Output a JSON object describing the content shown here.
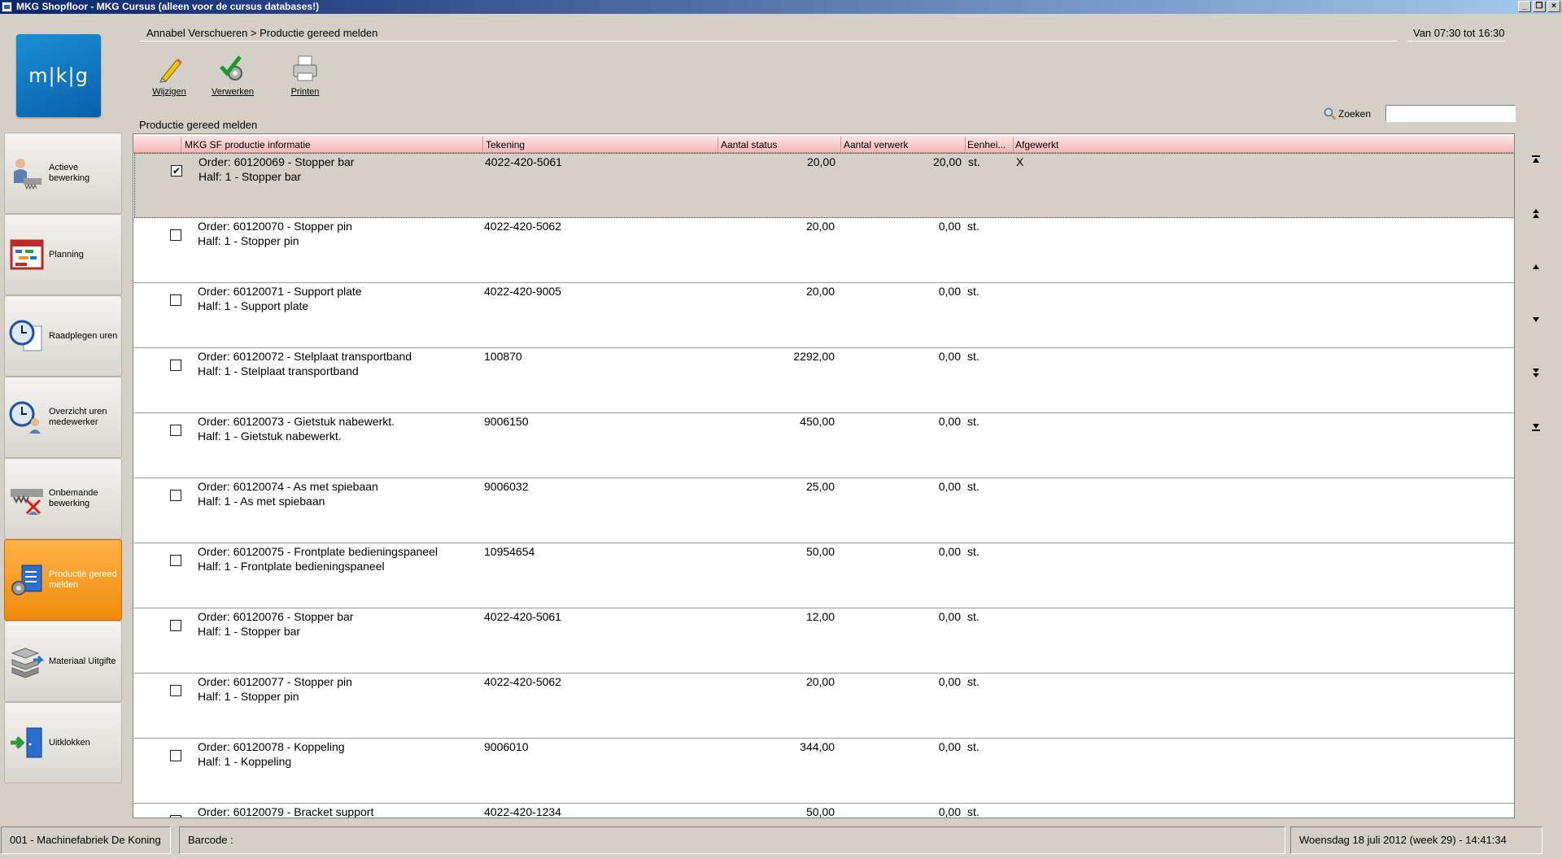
{
  "window": {
    "title": "MKG Shopfloor - MKG Cursus (alleen voor de cursus databases!)"
  },
  "logo": {
    "text": "m|k|g"
  },
  "header": {
    "breadcrumb": "Annabel Verschueren > Productie gereed melden",
    "shift": "Van 07:30 tot 16:30"
  },
  "toolbar": {
    "wijzigen": "Wijzigen",
    "verwerken": "Verwerken",
    "printen": "Printen"
  },
  "search": {
    "label": "Zoeken",
    "value": ""
  },
  "section_title": "Productie gereed melden",
  "sidebar": {
    "items": [
      {
        "label": "Actieve bewerking",
        "icon": "worker-machine-icon",
        "active": false
      },
      {
        "label": "Planning",
        "icon": "planning-calendar-icon",
        "active": false
      },
      {
        "label": "Raadplegen uren",
        "icon": "clock-document-icon",
        "active": false
      },
      {
        "label": "Overzicht uren medewerker",
        "icon": "clock-person-icon",
        "active": false
      },
      {
        "label": "Onbemande bewerking",
        "icon": "unmanned-machine-icon",
        "active": false
      },
      {
        "label": "Productie gereed melden",
        "icon": "production-report-icon",
        "active": true
      },
      {
        "label": "Materiaal Uitgifte",
        "icon": "material-stack-icon",
        "active": false
      },
      {
        "label": "Uitklokken",
        "icon": "door-exit-icon",
        "active": false
      }
    ]
  },
  "grid": {
    "columns": {
      "info": "MKG SF productie informatie",
      "tekening": "Tekening",
      "status": "Aantal status",
      "verwerk": "Aantal verwerk",
      "eenheid": "Eenhei...",
      "afgewerkt": "Afgewerkt"
    },
    "rows": [
      {
        "checked": true,
        "order": "Order: 60120069 - Stopper bar",
        "half": "Half: 1 - Stopper bar",
        "tekening": "4022-420-5061",
        "status": "20,00",
        "verwerk": "20,00",
        "eenheid": "st.",
        "afgewerkt": "X"
      },
      {
        "checked": false,
        "order": "Order: 60120070 - Stopper pin",
        "half": "Half: 1 - Stopper pin",
        "tekening": "4022-420-5062",
        "status": "20,00",
        "verwerk": "0,00",
        "eenheid": "st.",
        "afgewerkt": ""
      },
      {
        "checked": false,
        "order": "Order: 60120071 - Support plate",
        "half": "Half: 1 - Support plate",
        "tekening": "4022-420-9005",
        "status": "20,00",
        "verwerk": "0,00",
        "eenheid": "st.",
        "afgewerkt": ""
      },
      {
        "checked": false,
        "order": "Order: 60120072 - Stelplaat transportband",
        "half": "Half: 1 - Stelplaat transportband",
        "tekening": "100870",
        "status": "2292,00",
        "verwerk": "0,00",
        "eenheid": "st.",
        "afgewerkt": ""
      },
      {
        "checked": false,
        "order": "Order: 60120073 - Gietstuk nabewerkt.",
        "half": "Half: 1 - Gietstuk nabewerkt.",
        "tekening": "9006150",
        "status": "450,00",
        "verwerk": "0,00",
        "eenheid": "st.",
        "afgewerkt": ""
      },
      {
        "checked": false,
        "order": "Order: 60120074 - As met spiebaan",
        "half": "Half: 1 - As met spiebaan",
        "tekening": "9006032",
        "status": "25,00",
        "verwerk": "0,00",
        "eenheid": "st.",
        "afgewerkt": ""
      },
      {
        "checked": false,
        "order": "Order: 60120075 - Frontplate bedieningspaneel",
        "half": "Half: 1 - Frontplate bedieningspaneel",
        "tekening": "10954654",
        "status": "50,00",
        "verwerk": "0,00",
        "eenheid": "st.",
        "afgewerkt": ""
      },
      {
        "checked": false,
        "order": "Order: 60120076 - Stopper bar",
        "half": "Half: 1 - Stopper bar",
        "tekening": "4022-420-5061",
        "status": "12,00",
        "verwerk": "0,00",
        "eenheid": "st.",
        "afgewerkt": ""
      },
      {
        "checked": false,
        "order": "Order: 60120077 - Stopper pin",
        "half": "Half: 1 - Stopper pin",
        "tekening": "4022-420-5062",
        "status": "20,00",
        "verwerk": "0,00",
        "eenheid": "st.",
        "afgewerkt": ""
      },
      {
        "checked": false,
        "order": "Order: 60120078 - Koppeling",
        "half": "Half: 1 - Koppeling",
        "tekening": "9006010",
        "status": "344,00",
        "verwerk": "0,00",
        "eenheid": "st.",
        "afgewerkt": ""
      },
      {
        "checked": false,
        "order": "Order: 60120079 - Bracket support",
        "half": "",
        "tekening": "4022-420-1234",
        "status": "50,00",
        "verwerk": "0,00",
        "eenheid": "st.",
        "afgewerkt": ""
      }
    ]
  },
  "scroll_buttons": [
    "scroll-first-icon",
    "scroll-page-up-icon",
    "scroll-up-icon",
    "scroll-down-icon",
    "scroll-page-down-icon",
    "scroll-last-icon"
  ],
  "statusbar": {
    "company": "001 - Machinefabriek De Koning",
    "barcode": "Barcode :",
    "datetime": "Woensdag 18 juli 2012 (week 29) - 14:41:34"
  },
  "colors": {
    "active_nav": "#f08a0c",
    "header_row": "#f6b8b8",
    "logo": "#0a5fa8",
    "selected_row": "#d4d0c8"
  }
}
